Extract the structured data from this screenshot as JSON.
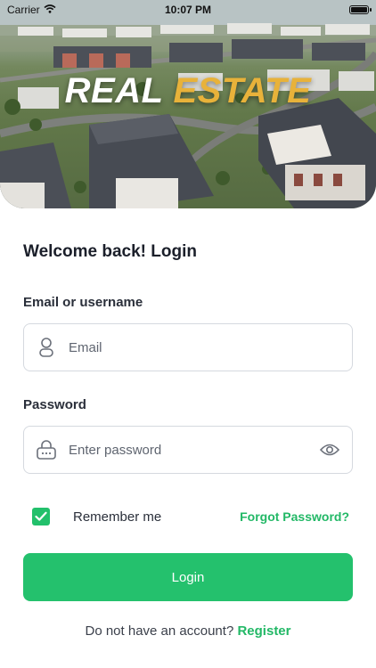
{
  "status_bar": {
    "carrier": "Carrier",
    "time": "10:07 PM"
  },
  "hero": {
    "logo_word_1": "REAL",
    "logo_word_2": "ESTATE"
  },
  "login_form": {
    "heading": "Welcome back! Login",
    "email_label": "Email or username",
    "email_placeholder": "Email",
    "password_label": "Password",
    "password_placeholder": "Enter password",
    "remember_label": "Remember me",
    "remember_checked": true,
    "forgot_label": "Forgot Password?",
    "login_label": "Login",
    "no_account_text": "Do not have an account?",
    "register_label": "Register"
  },
  "icons": {
    "user": "user-icon",
    "lock": "lock-icon",
    "eye": "eye-icon",
    "check": "checkmark-icon",
    "wifi": "wifi-icon",
    "battery": "battery-icon"
  },
  "colors": {
    "accent": "#24c16d",
    "link": "#22b866",
    "logo_gold": "#e8b23a",
    "border": "#d5d9df"
  }
}
